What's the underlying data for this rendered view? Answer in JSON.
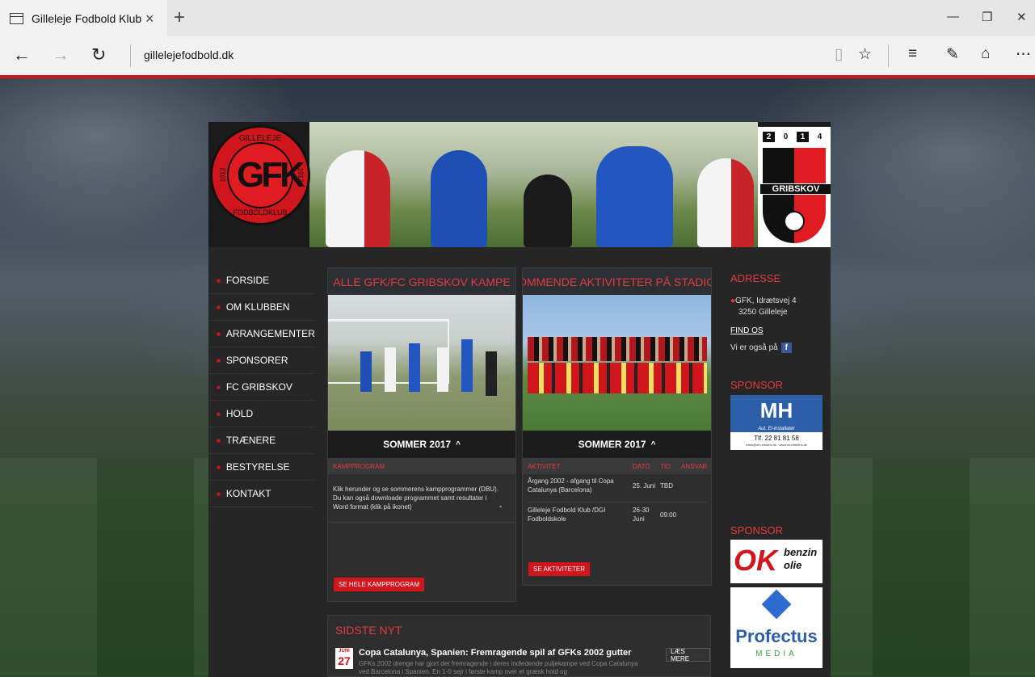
{
  "browser": {
    "tab_title": "Gilleleje Fodbold Klub",
    "tab_close": "×",
    "new_tab": "+",
    "url": "gillelejefodbold.dk",
    "icons": [
      "back-icon",
      "forward-icon",
      "refresh-icon",
      "reading-view-icon",
      "favorite-star-icon",
      "hub-icon",
      "web-note-icon",
      "share-icon",
      "more-icon"
    ]
  },
  "logo": {
    "top": "GILLELEJE",
    "letters": "GFK",
    "bottom": "FODBOLDKLUB",
    "year": "1912"
  },
  "gribskov": {
    "year_digits": [
      "2",
      "0",
      "1",
      "4"
    ],
    "name": "GRIBSKOV"
  },
  "nav": {
    "items": [
      "FORSIDE",
      "OM KLUBBEN",
      "ARRANGEMENTER",
      "SPONSORER",
      "FC GRIBSKOV",
      "HOLD",
      "TRÆNERE",
      "BESTYRELSE",
      "KONTAKT"
    ]
  },
  "panel_left": {
    "title": "ALLE GFK/FC GRIBSKOV KAMPE",
    "season": "SOMMER 2017",
    "table_header": "KAMPPROGRAM",
    "text": "Klik herunder og se sommerens kampprogrammer (DBU). Du kan også downloade programmet samt resultater i Word format (klik på ikonet)",
    "button": "SE HELE KAMPPROGRAM"
  },
  "panel_right": {
    "title": "KOMMENDE AKTIVITETER PÅ STADION",
    "season": "SOMMER 2017",
    "headers": [
      "AKTIVITET",
      "DATO",
      "TID",
      "ANSVAR"
    ],
    "rows": [
      {
        "activity": "Årgang 2002 - afgang til Copa Catalunya (Barcelona)",
        "date": "25. Juni",
        "time": "TBD"
      },
      {
        "activity": "Gilleleje Fodbold Klub /DGI Fodboldskole",
        "date": "26-30 Juni",
        "time": "09:00"
      }
    ],
    "button": "SE AKTIVITETER"
  },
  "sidebar": {
    "address_title": "ADRESSE",
    "address_line1": "GFK, Idrætsvej 4",
    "address_line2": "3250 Gilleleje",
    "find_us": "FIND OS",
    "social_text": "Vi er også på",
    "sponsor_title_1": "SPONSOR",
    "sponsor_title_2": "SPONSOR",
    "mh_name": "MH",
    "mh_sub": "Aut. El-installatør",
    "mh_phone": "Tlf. 22 81 81 58",
    "mh_contact": "mark@mh-elektric.dk · www.mh-elektric.dk",
    "ok_name": "OK",
    "ok_sub1": "benzin",
    "ok_sub2": "olie",
    "profectus_name": "Profectus",
    "profectus_sub": "MEDIA"
  },
  "news": {
    "title": "SIDSTE NYT",
    "month": "JUNI",
    "day": "27",
    "headline": "Copa Catalunya, Spanien: Fremragende spil af GFKs 2002 gutter",
    "excerpt": "GFKs 2002 drenge har gjort det fremragende i deres indledende puljekampe ved Copa Catalunya ved Barcelona i Spanien. En 1-0 sejr i første kamp over et græsk hold og",
    "read_more": "LÆS MERE"
  },
  "colors": {
    "accent_red": "#d0161c",
    "title_red": "#e23a3f",
    "panel_bg": "#2e2e2e"
  }
}
